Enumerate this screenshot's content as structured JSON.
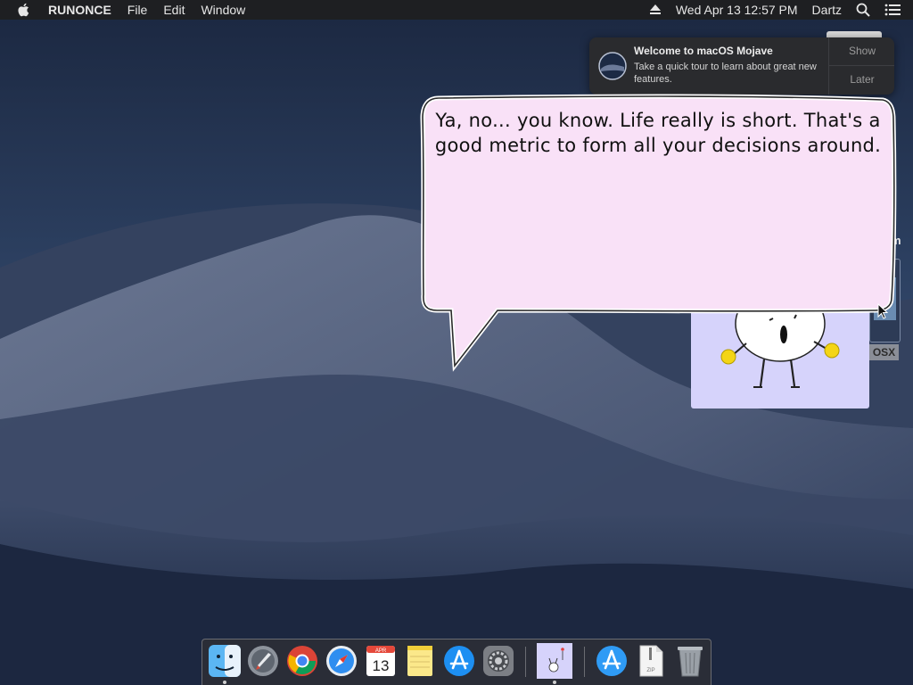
{
  "menubar": {
    "app_name": "RUNONCE",
    "menus": [
      "File",
      "Edit",
      "Window"
    ],
    "datetime": "Wed Apr 13  12:57 PM",
    "user": "Dartz"
  },
  "notification": {
    "title": "Welcome to macOS Mojave",
    "body": "Take a quick tour to learn about great new features.",
    "show_label": "Show",
    "later_label": "Later"
  },
  "bubble": {
    "text": "Ya, no... you know. Life really is short. That's a good metric to form all your decisions around."
  },
  "side": {
    "m_tag": "m",
    "osx_tag": "OSX"
  },
  "dock": {
    "items": [
      {
        "name": "finder-icon"
      },
      {
        "name": "launchpad-icon"
      },
      {
        "name": "chrome-icon"
      },
      {
        "name": "safari-icon"
      },
      {
        "name": "calendar-icon",
        "month": "APR",
        "day": "13"
      },
      {
        "name": "notes-icon"
      },
      {
        "name": "app-store-icon"
      },
      {
        "name": "system-preferences-icon"
      },
      {
        "name": "runonce-app-icon"
      },
      {
        "name": "app-store-folder-icon"
      },
      {
        "name": "zip-file-icon",
        "label": "ZIP"
      },
      {
        "name": "trash-icon"
      }
    ]
  },
  "colors": {
    "menubar_bg": "#1e1f22",
    "bubble_fill": "#f9e1f7",
    "char_panel_bg": "#d6d3fb",
    "hand_yellow": "#f4d515"
  }
}
